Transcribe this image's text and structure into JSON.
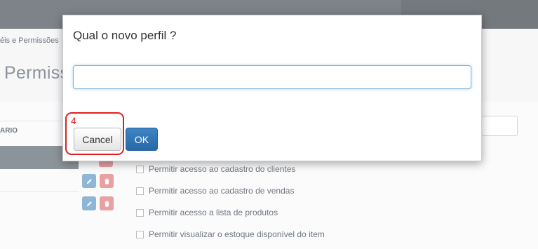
{
  "background": {
    "breadcrumb": "éis e Permissões",
    "page_title": "Permiss",
    "column_header": "ARIO",
    "permissions": [
      "Permitir acesso ao cadastro do clientes",
      "Permitir acesso ao cadastro de vendas",
      "Permitir acesso a lista de produtos",
      "Permitir visualizar o estoque disponível do item"
    ]
  },
  "dialog": {
    "title": "Qual o novo perfil ?",
    "input_value": "",
    "input_placeholder": "",
    "cancel_label": "Cancel",
    "ok_label": "OK"
  },
  "annotation": {
    "step_number": "4",
    "color": "#e02020"
  },
  "icons": {
    "edit": "pencil-icon",
    "delete": "trash-icon"
  },
  "colors": {
    "primary": "#2f73b6",
    "edit_button": "#8eb6d6",
    "delete_button": "#e8a0a0"
  }
}
